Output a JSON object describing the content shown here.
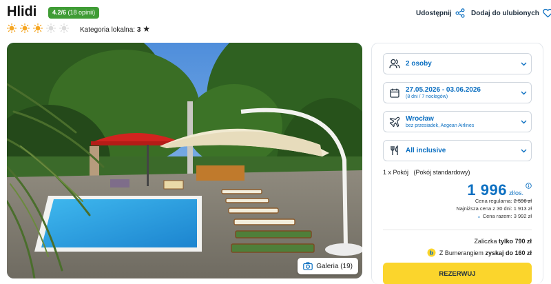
{
  "hotel": {
    "name": "Hlidi",
    "rating_score": "4.2/6",
    "rating_reviews": "(18 opinii)",
    "sun_count": 5,
    "sun_filled": 3,
    "local_category_label": "Kategoria lokalna:",
    "local_category_value": "3"
  },
  "header": {
    "share_label": "Udostępnij",
    "favorite_label": "Dodaj do ulubionych"
  },
  "gallery": {
    "button_label": "Galeria (19)"
  },
  "booking": {
    "persons": "2 osoby",
    "dates": "27.05.2026 - 03.06.2026",
    "dates_sub": "(8 dni / 7 noclegów)",
    "departure": "Wrocław",
    "departure_sub": "bez przesiadek, Aegean Airlines",
    "board": "All inclusive",
    "room": "1 x Pokój   (Pokój standardowy)",
    "price": "1 996",
    "price_unit": "zł/os.",
    "regular_price_label": "Cena regularna:",
    "regular_price_value": "2 596 zł",
    "lowest_price_label": "Najniższa cena z 30 dni:",
    "lowest_price_value": "1 913 zł",
    "total_price_label": "Cena razem:",
    "total_price_value": "3 992 zł",
    "deposit_label": "Zaliczka",
    "deposit_value": "tylko 790 zł",
    "bumerang_prefix": "Z Bumerangiem",
    "bumerang_value": "zyskaj do 160 zł",
    "book_button": "REZERWUJ"
  },
  "colors": {
    "accent_blue": "#0b6fc1",
    "rating_green": "#3f9c35",
    "book_yellow": "#fbd52c",
    "sun_orange": "#f5a623"
  }
}
